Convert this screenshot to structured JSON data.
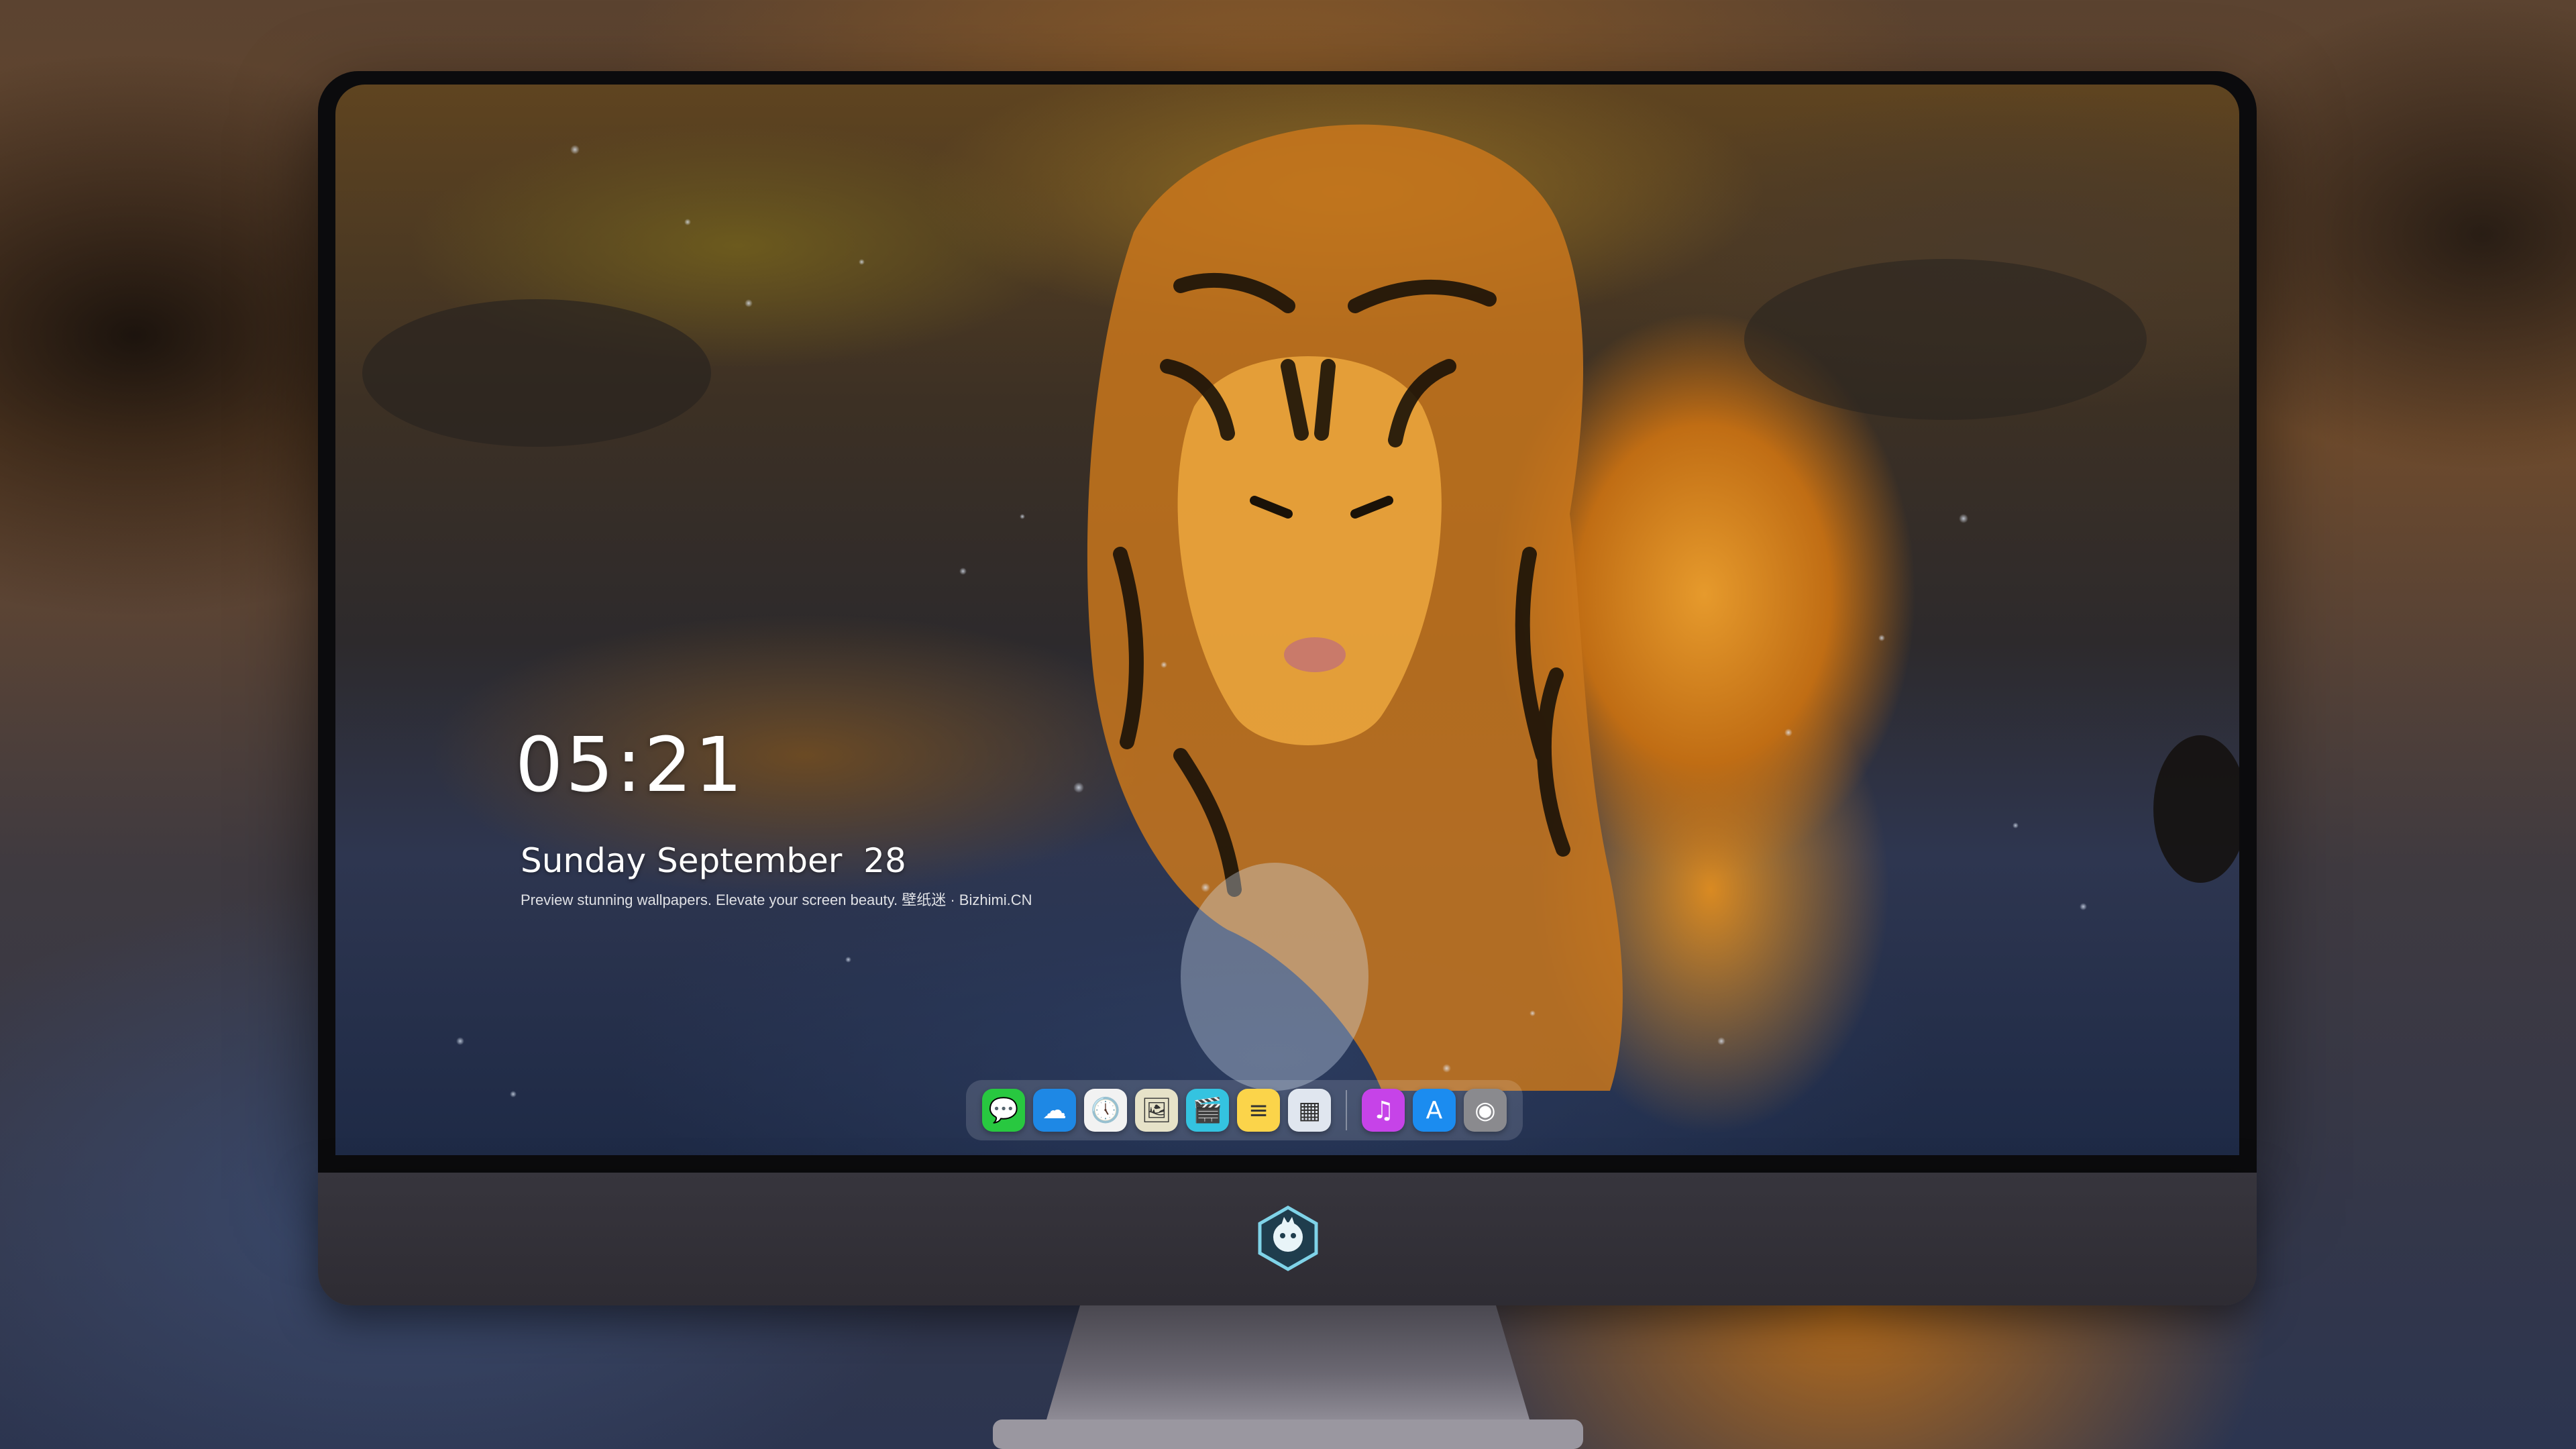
{
  "lockscreen": {
    "time": "05:21",
    "date": "Sunday September  28",
    "caption": "Preview stunning wallpapers. Elevate your screen beauty. 壁纸迷 · Bizhimi.CN"
  },
  "dock": {
    "apps": [
      {
        "name": "messages",
        "icon": "message-bubble-icon",
        "color": "#28c840",
        "glyph": "💬"
      },
      {
        "name": "weather",
        "icon": "cloud-icon",
        "color": "#1e88e5",
        "glyph": "☁"
      },
      {
        "name": "clock",
        "icon": "clock-icon",
        "color": "#f2f2f2",
        "glyph": "🕔"
      },
      {
        "name": "preview",
        "icon": "photo-viewer-icon",
        "color": "#e6e2c8",
        "glyph": "🖼"
      },
      {
        "name": "claquette",
        "icon": "clapperboard-icon",
        "color": "#34c3e0",
        "glyph": "🎬"
      },
      {
        "name": "notes",
        "icon": "notes-icon",
        "color": "#fbd44a",
        "glyph": "≡"
      },
      {
        "name": "photo-booth",
        "icon": "photo-collage-icon",
        "color": "#e0e6ef",
        "glyph": "▦"
      },
      {
        "name": "music",
        "icon": "music-note-icon",
        "color": "#c643e8",
        "glyph": "♫"
      },
      {
        "name": "app-store",
        "icon": "app-store-icon",
        "color": "#1b8cf0",
        "glyph": "A"
      },
      {
        "name": "camera",
        "icon": "camera-icon",
        "color": "#8a8a8e",
        "glyph": "◉"
      }
    ]
  },
  "colors": {
    "screen_bezel": "#0b0b0d",
    "chin": "#37353d",
    "dock_background": "rgba(255,255,255,0.14)"
  }
}
